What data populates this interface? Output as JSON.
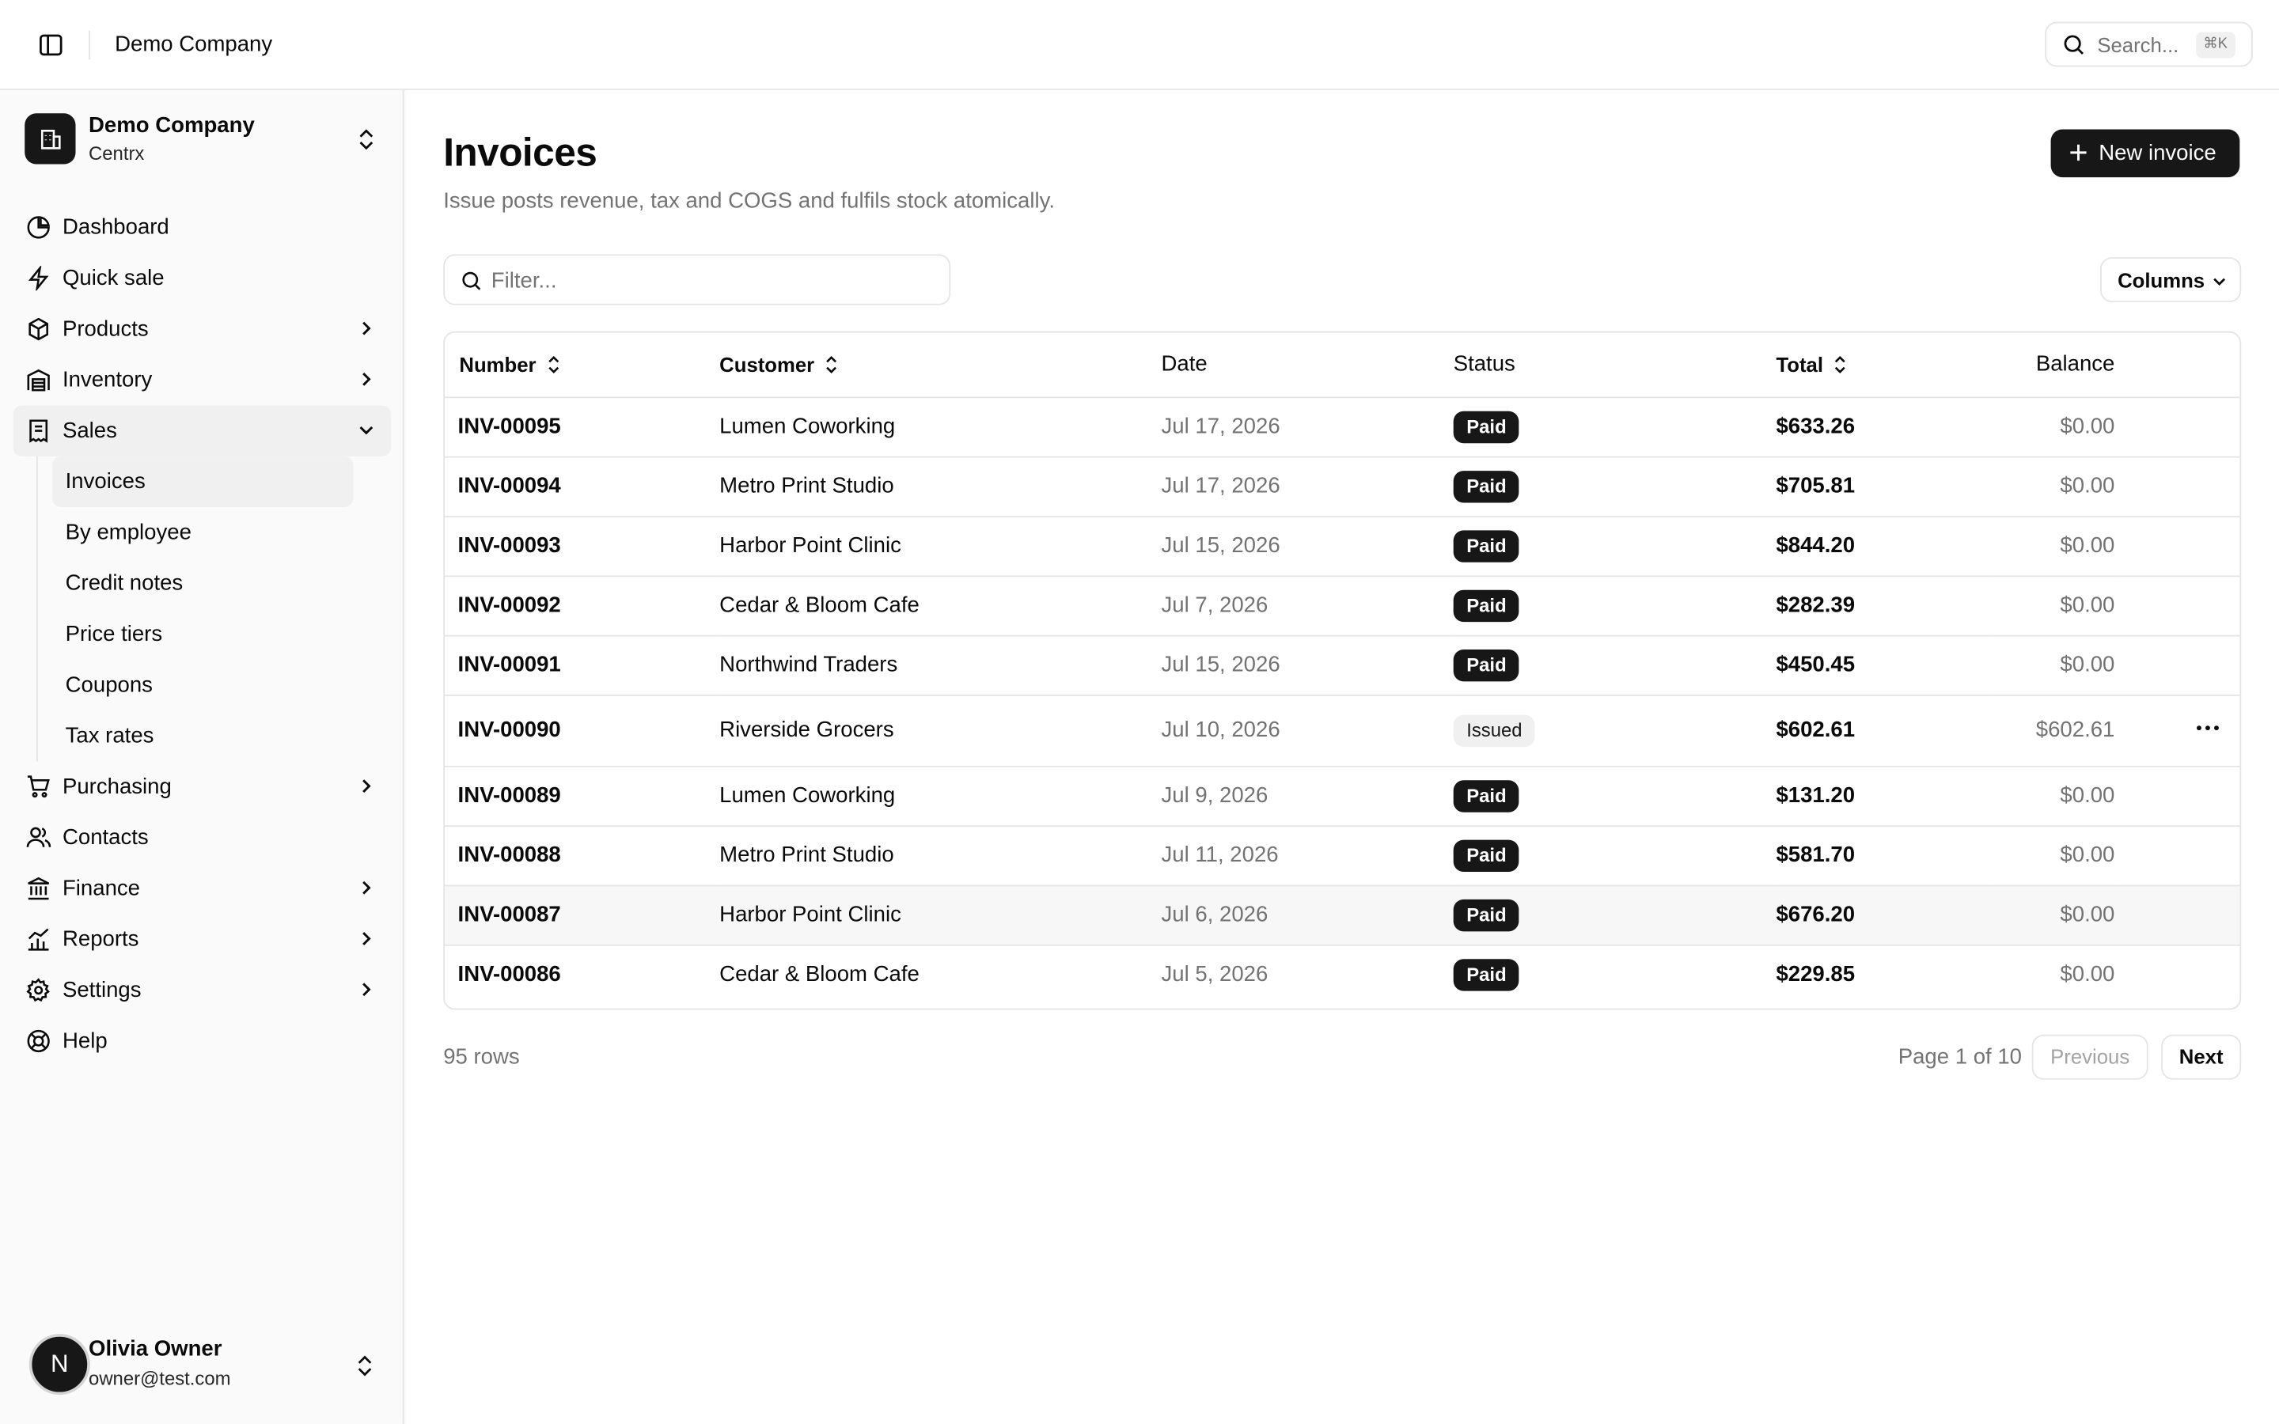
{
  "header": {
    "breadcrumb": "Demo Company",
    "search_placeholder": "Search...",
    "search_shortcut": "⌘K"
  },
  "sidebar": {
    "org_name": "Demo Company",
    "org_sub": "Centrx",
    "items": [
      {
        "label": "Dashboard",
        "icon": "pie-chart-icon"
      },
      {
        "label": "Quick sale",
        "icon": "zap-icon"
      },
      {
        "label": "Products",
        "icon": "package-icon"
      },
      {
        "label": "Inventory",
        "icon": "warehouse-icon"
      },
      {
        "label": "Sales",
        "icon": "receipt-icon"
      },
      {
        "label": "Purchasing",
        "icon": "cart-icon"
      },
      {
        "label": "Contacts",
        "icon": "users-icon"
      },
      {
        "label": "Finance",
        "icon": "bank-icon"
      },
      {
        "label": "Reports",
        "icon": "chart-icon"
      },
      {
        "label": "Settings",
        "icon": "gear-icon"
      },
      {
        "label": "Help",
        "icon": "lifebuoy-icon"
      }
    ],
    "sales_sub": [
      "Invoices",
      "By employee",
      "Credit notes",
      "Price tiers",
      "Coupons",
      "Tax rates"
    ],
    "user": {
      "initial": "N",
      "name": "Olivia Owner",
      "email": "owner@test.com"
    }
  },
  "page": {
    "title": "Invoices",
    "description": "Issue posts revenue, tax and COGS and fulfils stock atomically.",
    "new_button": "New invoice",
    "filter_placeholder": "Filter...",
    "columns_button": "Columns"
  },
  "table": {
    "headers": {
      "number": "Number",
      "customer": "Customer",
      "date": "Date",
      "status": "Status",
      "total": "Total",
      "balance": "Balance"
    },
    "rows": [
      {
        "number": "INV-00095",
        "customer": "Lumen Coworking",
        "date": "Jul 17, 2026",
        "status": "Paid",
        "total": "$633.26",
        "balance": "$0.00"
      },
      {
        "number": "INV-00094",
        "customer": "Metro Print Studio",
        "date": "Jul 17, 2026",
        "status": "Paid",
        "total": "$705.81",
        "balance": "$0.00"
      },
      {
        "number": "INV-00093",
        "customer": "Harbor Point Clinic",
        "date": "Jul 15, 2026",
        "status": "Paid",
        "total": "$844.20",
        "balance": "$0.00"
      },
      {
        "number": "INV-00092",
        "customer": "Cedar & Bloom Cafe",
        "date": "Jul 7, 2026",
        "status": "Paid",
        "total": "$282.39",
        "balance": "$0.00"
      },
      {
        "number": "INV-00091",
        "customer": "Northwind Traders",
        "date": "Jul 15, 2026",
        "status": "Paid",
        "total": "$450.45",
        "balance": "$0.00"
      },
      {
        "number": "INV-00090",
        "customer": "Riverside Grocers",
        "date": "Jul 10, 2026",
        "status": "Issued",
        "total": "$602.61",
        "balance": "$602.61"
      },
      {
        "number": "INV-00089",
        "customer": "Lumen Coworking",
        "date": "Jul 9, 2026",
        "status": "Paid",
        "total": "$131.20",
        "balance": "$0.00"
      },
      {
        "number": "INV-00088",
        "customer": "Metro Print Studio",
        "date": "Jul 11, 2026",
        "status": "Paid",
        "total": "$581.70",
        "balance": "$0.00"
      },
      {
        "number": "INV-00087",
        "customer": "Harbor Point Clinic",
        "date": "Jul 6, 2026",
        "status": "Paid",
        "total": "$676.20",
        "balance": "$0.00"
      },
      {
        "number": "INV-00086",
        "customer": "Cedar & Bloom Cafe",
        "date": "Jul 5, 2026",
        "status": "Paid",
        "total": "$229.85",
        "balance": "$0.00"
      }
    ]
  },
  "footer": {
    "rows_count": "95 rows",
    "page_info": "Page 1 of 10",
    "previous": "Previous",
    "next": "Next"
  }
}
